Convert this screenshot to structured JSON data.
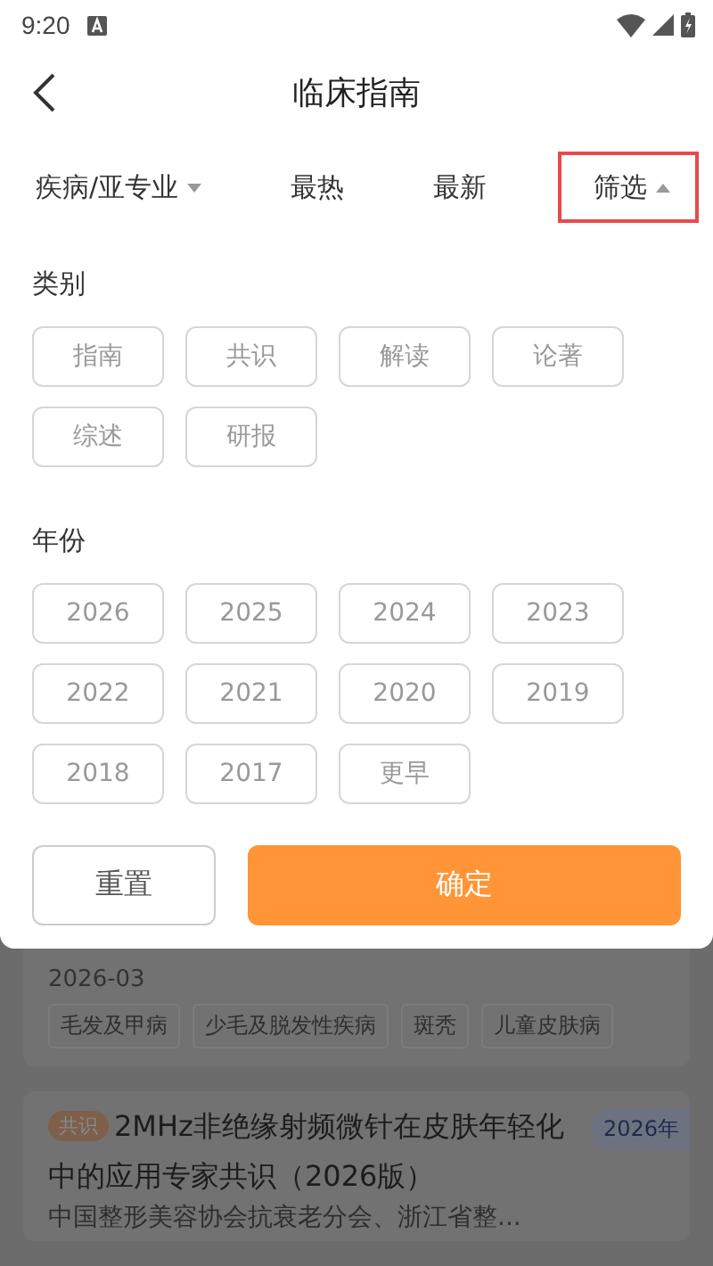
{
  "status_bar": {
    "time": "9:20"
  },
  "header": {
    "title": "临床指南"
  },
  "tabs": [
    {
      "label": "疾病/亚专业",
      "kind": "dropdown",
      "selected": false
    },
    {
      "label": "最热",
      "kind": "plain",
      "selected": false
    },
    {
      "label": "最新",
      "kind": "plain",
      "selected": false
    },
    {
      "label": "筛选",
      "kind": "dropdown",
      "selected": true
    }
  ],
  "filter": {
    "sections": [
      {
        "title": "类别",
        "chips": [
          {
            "label": "指南",
            "selected": false
          },
          {
            "label": "共识",
            "selected": false
          },
          {
            "label": "解读",
            "selected": false
          },
          {
            "label": "论著",
            "selected": false
          },
          {
            "label": "综述",
            "selected": false
          },
          {
            "label": "研报",
            "selected": false
          }
        ]
      },
      {
        "title": "年份",
        "chips": [
          {
            "label": "2026",
            "selected": false
          },
          {
            "label": "2025",
            "selected": false
          },
          {
            "label": "2024",
            "selected": false
          },
          {
            "label": "2023",
            "selected": false
          },
          {
            "label": "2022",
            "selected": false
          },
          {
            "label": "2021",
            "selected": false
          },
          {
            "label": "2020",
            "selected": false
          },
          {
            "label": "2019",
            "selected": false
          },
          {
            "label": "2018",
            "selected": false
          },
          {
            "label": "2017",
            "selected": false
          },
          {
            "label": "更早",
            "selected": false
          }
        ]
      }
    ],
    "buttons": [
      {
        "label": "重置",
        "kind": "secondary"
      },
      {
        "label": "确定",
        "kind": "primary"
      }
    ]
  },
  "list": [
    {
      "date": "2026-03",
      "tags": [
        "毛发及甲病",
        "少毛及脱发性疾病",
        "斑秃",
        "儿童皮肤病"
      ]
    },
    {
      "type_badge": "共识",
      "title": "2MHz非绝缘射频微针在皮肤年轻化中的应用专家共识（2026版）",
      "year_badge": "2026年",
      "authors": "中国整形美容协会抗衰老分会、浙江省整..."
    }
  ]
}
